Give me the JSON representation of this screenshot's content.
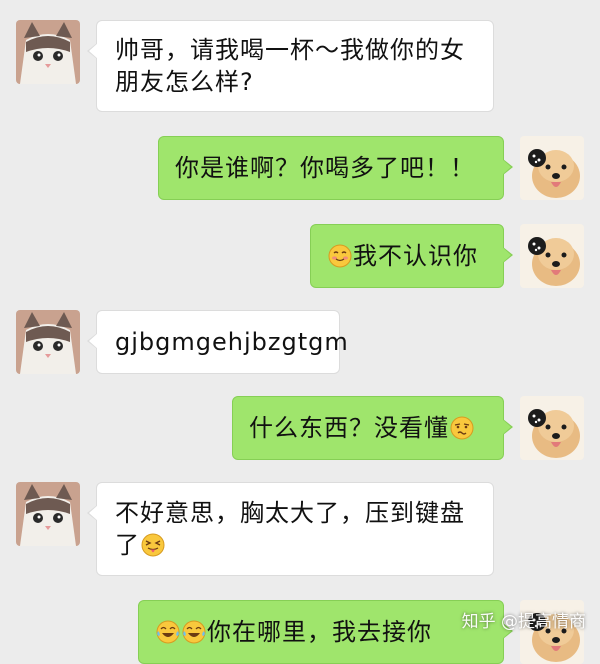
{
  "messages": [
    {
      "side": "in",
      "text": "帅哥，请我喝一杯～我做你的女朋友怎么样?"
    },
    {
      "side": "out",
      "text": "你是谁啊？你喝多了吧！！"
    },
    {
      "side": "out",
      "text": "我不认识你",
      "emoji": "smile-blush-icon"
    },
    {
      "side": "in",
      "text": "gjbgmgehjbzgtgm"
    },
    {
      "side": "out",
      "text": "什么东西？没看懂",
      "emoji": "confused-face-icon"
    },
    {
      "side": "in",
      "text": "不好意思，胸太大了，压到键盘了",
      "emoji": "tongue-out-icon"
    },
    {
      "side": "out",
      "text": "你在哪里，我去接你",
      "emoji": "tears-of-joy-icon"
    }
  ],
  "watermark": {
    "text": "知乎 @提高情商"
  },
  "colors": {
    "background": "#ececec",
    "outgoing_bubble": "#9fe56c",
    "incoming_bubble": "#ffffff"
  }
}
